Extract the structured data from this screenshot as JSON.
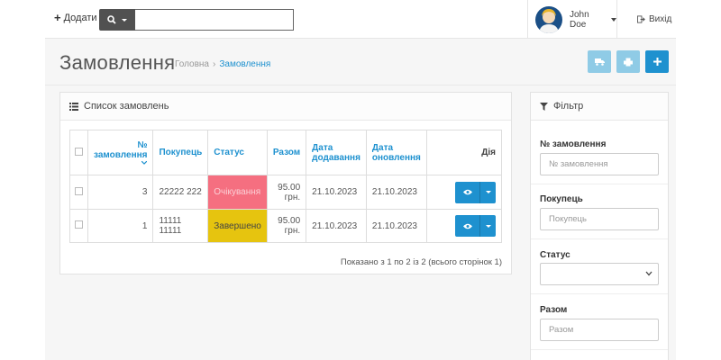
{
  "header": {
    "add_label": "Додати",
    "search_placeholder": "",
    "user_name": "John Doe",
    "logout_label": "Вихід"
  },
  "page": {
    "title": "Замовлення",
    "breadcrumb": [
      "Головна",
      "Замовлення"
    ],
    "separator": "›"
  },
  "orders_panel": {
    "heading": "Список замовлень",
    "columns": {
      "order_no": "№ замовлення",
      "customer": "Покупець",
      "status": "Статус",
      "total": "Разом",
      "date_added": "Дата додавання",
      "date_modified": "Дата оновлення",
      "action": "Дія"
    },
    "rows": [
      {
        "order_no": "3",
        "customer": "22222 222",
        "status": "Очікування",
        "status_color": "#f56f80",
        "total": "95.00 грн.",
        "date_added": "21.10.2023",
        "date_modified": "21.10.2023"
      },
      {
        "order_no": "1",
        "customer": "11111 11111",
        "status": "Завершено",
        "status_color": "#e6c40f",
        "total": "95.00 грн.",
        "date_added": "21.10.2023",
        "date_modified": "21.10.2023"
      }
    ],
    "pagination_text": "Показано з 1 по 2 із 2 (всього сторінок 1)"
  },
  "filter": {
    "heading": "Фільтр",
    "order_id_label": "№ замовлення",
    "order_id_placeholder": "№ замовлення",
    "customer_label": "Покупець",
    "customer_placeholder": "Покупець",
    "status_label": "Статус",
    "status_value": "",
    "total_label": "Разом",
    "total_placeholder": "Разом"
  },
  "colors": {
    "accent": "#1e91cf",
    "accent_disabled": "#8fcbe6",
    "status_pending": "#f56f80",
    "status_complete": "#e6c40f"
  },
  "icons": [
    "plus-icon",
    "search-icon",
    "logout-icon",
    "truck-icon",
    "print-icon",
    "list-icon",
    "filter-icon",
    "eye-icon",
    "sort-down-icon"
  ]
}
